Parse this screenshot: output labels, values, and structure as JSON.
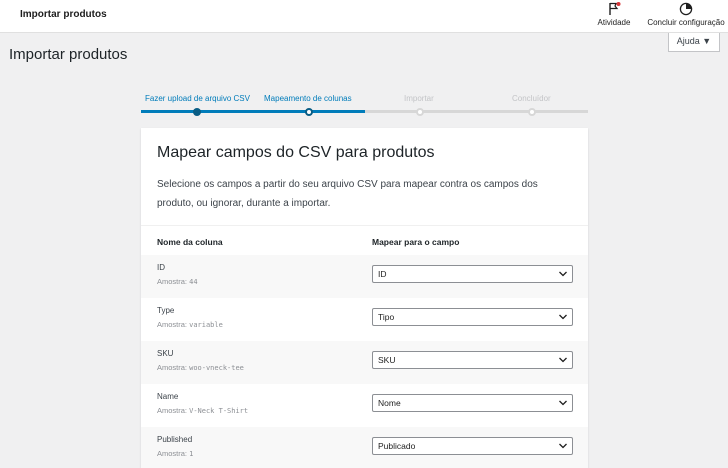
{
  "header": {
    "title": "Importar produtos",
    "activity_label": "Atividade",
    "setup_label": "Concluir configuração"
  },
  "help": {
    "label": "Ajuda ▼"
  },
  "page": {
    "title": "Importar produtos"
  },
  "steps": [
    {
      "label": "Fazer upload de arquivo CSV",
      "state": "done"
    },
    {
      "label": "Mapeamento de colunas",
      "state": "current"
    },
    {
      "label": "Importar",
      "state": "todo"
    },
    {
      "label": "Concluídor",
      "state": "todo"
    }
  ],
  "card": {
    "title": "Mapear campos do CSV para produtos",
    "description": "Selecione os campos a partir do seu arquivo CSV para mapear contra os campos dos produto, ou ignorar, durante a importar.",
    "col_name": "Nome da coluna",
    "col_map": "Mapear para o campo",
    "sample_prefix": "Amostra:",
    "rows": [
      {
        "name": "ID",
        "sample": "44",
        "mapped": "ID"
      },
      {
        "name": "Type",
        "sample": "variable",
        "mapped": "Tipo"
      },
      {
        "name": "SKU",
        "sample": "woo-vneck-tee",
        "mapped": "SKU"
      },
      {
        "name": "Name",
        "sample": "V-Neck T-Shirt",
        "mapped": "Nome"
      },
      {
        "name": "Published",
        "sample": "1",
        "mapped": "Publicado"
      }
    ]
  },
  "colors": {
    "accent": "#007cba",
    "accent_dark": "#0a5d85",
    "notification": "#d63638"
  },
  "icons": {
    "activity": "flag-icon",
    "setup": "progress-circle-icon",
    "select": "chevron-down-icon"
  }
}
